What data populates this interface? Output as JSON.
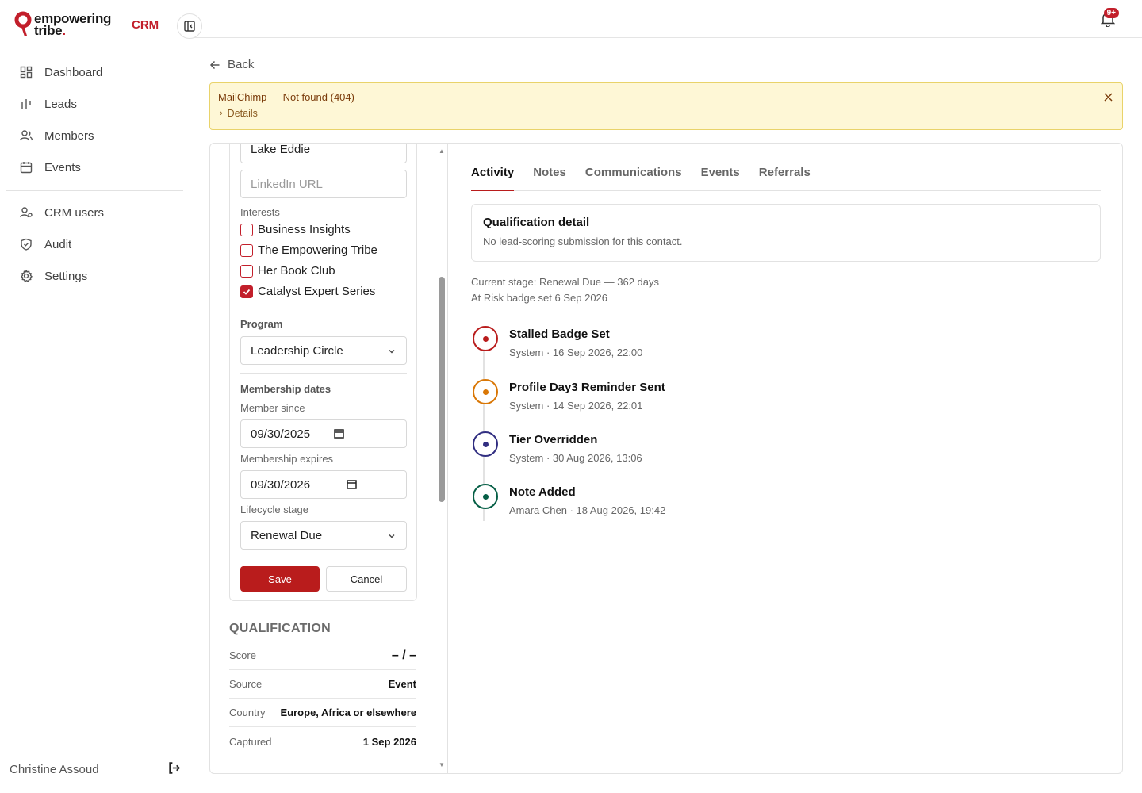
{
  "brand": {
    "line1": "empowering",
    "line2": "tribe",
    "dot": ".",
    "app": "CRM",
    "accent": "#c21f2b"
  },
  "nav": [
    {
      "label": "Dashboard",
      "icon": "dashboard-icon"
    },
    {
      "label": "Leads",
      "icon": "leads-icon"
    },
    {
      "label": "Members",
      "icon": "members-icon"
    },
    {
      "label": "Events",
      "icon": "calendar-icon"
    }
  ],
  "nav2": [
    {
      "label": "CRM users",
      "icon": "crm-users-icon"
    },
    {
      "label": "Audit",
      "icon": "shield-icon"
    },
    {
      "label": "Settings",
      "icon": "gear-icon"
    }
  ],
  "user": {
    "name": "Christine Assoud"
  },
  "topbar": {
    "notifications_badge": "9+"
  },
  "back_label": "Back",
  "alert": {
    "title": "MailChimp — Not found (404)",
    "details_label": "Details"
  },
  "form": {
    "city_value": "Lake Eddie",
    "linkedin_placeholder": "LinkedIn URL",
    "interests_label": "Interests",
    "interests": [
      {
        "label": "Business Insights",
        "checked": false
      },
      {
        "label": "The Empowering Tribe",
        "checked": false
      },
      {
        "label": "Her Book Club",
        "checked": false
      },
      {
        "label": "Catalyst Expert Series",
        "checked": true
      }
    ],
    "program_label": "Program",
    "program_value": "Leadership Circle",
    "membership_dates_label": "Membership dates",
    "member_since_label": "Member since",
    "member_since_value": "09/30/2025",
    "expires_label": "Membership expires",
    "expires_value": "09/30/2026",
    "lifecycle_label": "Lifecycle stage",
    "lifecycle_value": "Renewal Due",
    "save_label": "Save",
    "cancel_label": "Cancel"
  },
  "qualification": {
    "title": "QUALIFICATION",
    "rows": [
      {
        "key": "Score",
        "value": "– / –"
      },
      {
        "key": "Source",
        "value": "Event"
      },
      {
        "key": "Country",
        "value": "Europe, Africa or elsewhere"
      },
      {
        "key": "Captured",
        "value": "1 Sep 2026"
      }
    ]
  },
  "tabs": [
    "Activity",
    "Notes",
    "Communications",
    "Events",
    "Referrals"
  ],
  "qualification_detail": {
    "title": "Qualification detail",
    "text": "No lead-scoring submission for this contact."
  },
  "stage": {
    "line1": "Current stage: Renewal Due — 362 days",
    "line2": "At Risk badge set 6 Sep 2026"
  },
  "timeline": [
    {
      "title": "Stalled Badge Set",
      "meta": "System · 16 Sep 2026, 22:00",
      "color": "#b91c1c"
    },
    {
      "title": "Profile Day3 Reminder Sent",
      "meta": "System · 14 Sep 2026, 22:01",
      "color": "#d97706"
    },
    {
      "title": "Tier Overridden",
      "meta": "System · 30 Aug 2026, 13:06",
      "color": "#312e81"
    },
    {
      "title": "Note Added",
      "meta": "Amara Chen · 18 Aug 2026, 19:42",
      "color": "#065f46"
    }
  ]
}
